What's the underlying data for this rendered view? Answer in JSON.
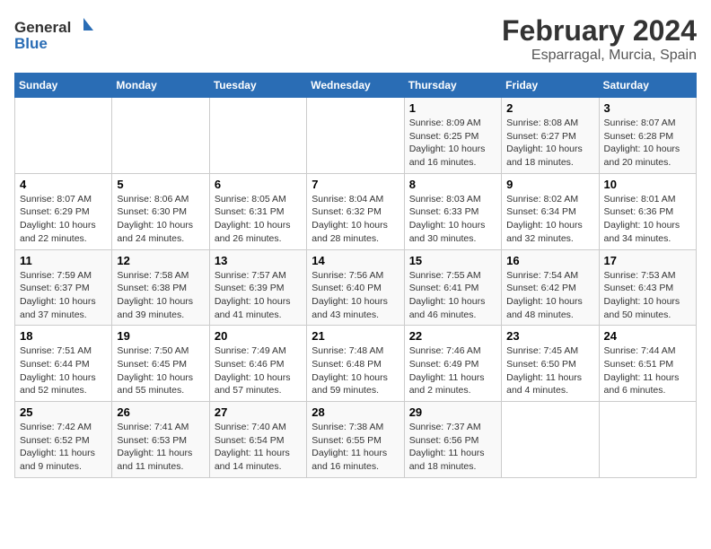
{
  "logo": {
    "general": "General",
    "blue": "Blue"
  },
  "title": "February 2024",
  "subtitle": "Esparragal, Murcia, Spain",
  "days_of_week": [
    "Sunday",
    "Monday",
    "Tuesday",
    "Wednesday",
    "Thursday",
    "Friday",
    "Saturday"
  ],
  "weeks": [
    [
      {
        "day": "",
        "info": ""
      },
      {
        "day": "",
        "info": ""
      },
      {
        "day": "",
        "info": ""
      },
      {
        "day": "",
        "info": ""
      },
      {
        "day": "1",
        "info": "Sunrise: 8:09 AM\nSunset: 6:25 PM\nDaylight: 10 hours\nand 16 minutes."
      },
      {
        "day": "2",
        "info": "Sunrise: 8:08 AM\nSunset: 6:27 PM\nDaylight: 10 hours\nand 18 minutes."
      },
      {
        "day": "3",
        "info": "Sunrise: 8:07 AM\nSunset: 6:28 PM\nDaylight: 10 hours\nand 20 minutes."
      }
    ],
    [
      {
        "day": "4",
        "info": "Sunrise: 8:07 AM\nSunset: 6:29 PM\nDaylight: 10 hours\nand 22 minutes."
      },
      {
        "day": "5",
        "info": "Sunrise: 8:06 AM\nSunset: 6:30 PM\nDaylight: 10 hours\nand 24 minutes."
      },
      {
        "day": "6",
        "info": "Sunrise: 8:05 AM\nSunset: 6:31 PM\nDaylight: 10 hours\nand 26 minutes."
      },
      {
        "day": "7",
        "info": "Sunrise: 8:04 AM\nSunset: 6:32 PM\nDaylight: 10 hours\nand 28 minutes."
      },
      {
        "day": "8",
        "info": "Sunrise: 8:03 AM\nSunset: 6:33 PM\nDaylight: 10 hours\nand 30 minutes."
      },
      {
        "day": "9",
        "info": "Sunrise: 8:02 AM\nSunset: 6:34 PM\nDaylight: 10 hours\nand 32 minutes."
      },
      {
        "day": "10",
        "info": "Sunrise: 8:01 AM\nSunset: 6:36 PM\nDaylight: 10 hours\nand 34 minutes."
      }
    ],
    [
      {
        "day": "11",
        "info": "Sunrise: 7:59 AM\nSunset: 6:37 PM\nDaylight: 10 hours\nand 37 minutes."
      },
      {
        "day": "12",
        "info": "Sunrise: 7:58 AM\nSunset: 6:38 PM\nDaylight: 10 hours\nand 39 minutes."
      },
      {
        "day": "13",
        "info": "Sunrise: 7:57 AM\nSunset: 6:39 PM\nDaylight: 10 hours\nand 41 minutes."
      },
      {
        "day": "14",
        "info": "Sunrise: 7:56 AM\nSunset: 6:40 PM\nDaylight: 10 hours\nand 43 minutes."
      },
      {
        "day": "15",
        "info": "Sunrise: 7:55 AM\nSunset: 6:41 PM\nDaylight: 10 hours\nand 46 minutes."
      },
      {
        "day": "16",
        "info": "Sunrise: 7:54 AM\nSunset: 6:42 PM\nDaylight: 10 hours\nand 48 minutes."
      },
      {
        "day": "17",
        "info": "Sunrise: 7:53 AM\nSunset: 6:43 PM\nDaylight: 10 hours\nand 50 minutes."
      }
    ],
    [
      {
        "day": "18",
        "info": "Sunrise: 7:51 AM\nSunset: 6:44 PM\nDaylight: 10 hours\nand 52 minutes."
      },
      {
        "day": "19",
        "info": "Sunrise: 7:50 AM\nSunset: 6:45 PM\nDaylight: 10 hours\nand 55 minutes."
      },
      {
        "day": "20",
        "info": "Sunrise: 7:49 AM\nSunset: 6:46 PM\nDaylight: 10 hours\nand 57 minutes."
      },
      {
        "day": "21",
        "info": "Sunrise: 7:48 AM\nSunset: 6:48 PM\nDaylight: 10 hours\nand 59 minutes."
      },
      {
        "day": "22",
        "info": "Sunrise: 7:46 AM\nSunset: 6:49 PM\nDaylight: 11 hours\nand 2 minutes."
      },
      {
        "day": "23",
        "info": "Sunrise: 7:45 AM\nSunset: 6:50 PM\nDaylight: 11 hours\nand 4 minutes."
      },
      {
        "day": "24",
        "info": "Sunrise: 7:44 AM\nSunset: 6:51 PM\nDaylight: 11 hours\nand 6 minutes."
      }
    ],
    [
      {
        "day": "25",
        "info": "Sunrise: 7:42 AM\nSunset: 6:52 PM\nDaylight: 11 hours\nand 9 minutes."
      },
      {
        "day": "26",
        "info": "Sunrise: 7:41 AM\nSunset: 6:53 PM\nDaylight: 11 hours\nand 11 minutes."
      },
      {
        "day": "27",
        "info": "Sunrise: 7:40 AM\nSunset: 6:54 PM\nDaylight: 11 hours\nand 14 minutes."
      },
      {
        "day": "28",
        "info": "Sunrise: 7:38 AM\nSunset: 6:55 PM\nDaylight: 11 hours\nand 16 minutes."
      },
      {
        "day": "29",
        "info": "Sunrise: 7:37 AM\nSunset: 6:56 PM\nDaylight: 11 hours\nand 18 minutes."
      },
      {
        "day": "",
        "info": ""
      },
      {
        "day": "",
        "info": ""
      }
    ]
  ]
}
